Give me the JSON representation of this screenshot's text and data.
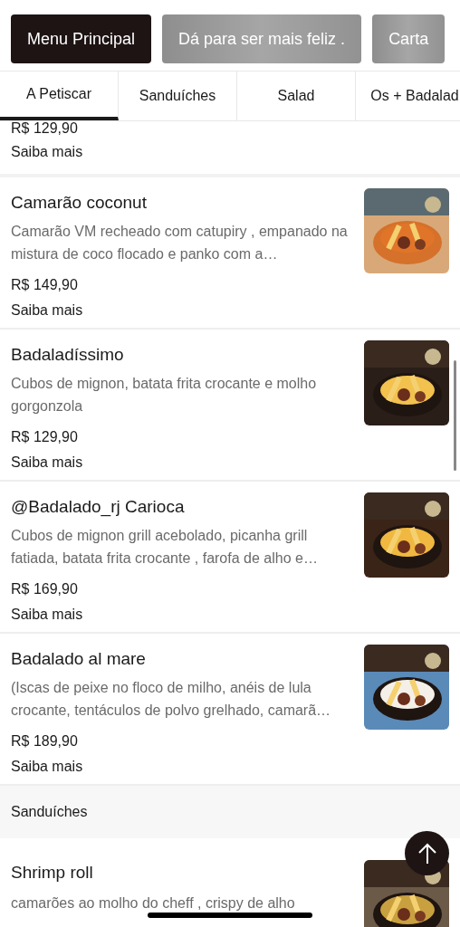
{
  "menus": [
    {
      "label": "Menu Principal",
      "selected": true
    },
    {
      "label": "Dá para ser mais feliz .",
      "selected": false
    },
    {
      "label": "Carta",
      "selected": false
    }
  ],
  "tabs": [
    {
      "label": "A Petiscar",
      "selected": true
    },
    {
      "label": "Sanduíches",
      "selected": false
    },
    {
      "label": "Salad",
      "selected": false
    },
    {
      "label": "Os + Badalad",
      "selected": false
    }
  ],
  "partial_item": {
    "price": "R$ 129,90",
    "link": "Saiba mais"
  },
  "items": [
    {
      "name": "Camarão coconut",
      "description": "Camarão VM recheado com catupiry , empanado na mistura de coco flocado e panko com a…",
      "price": "R$ 149,90",
      "link": "Saiba mais"
    },
    {
      "name": "Badaladíssimo",
      "description": "Cubos de mignon, batata frita crocante e molho gorgonzola",
      "price": "R$ 129,90",
      "link": "Saiba mais"
    },
    {
      "name": "@Badalado_rj Carioca",
      "description": "Cubos de mignon grill acebolado, picanha grill fatiada, batata frita crocante , farofa de alho e…",
      "price": "R$ 169,90",
      "link": "Saiba mais"
    },
    {
      "name": "Badalado al mare",
      "description": "(Iscas de peixe no floco de milho, anéis de lula crocante, tentáculos de polvo grelhado, camarã…",
      "price": "R$ 189,90",
      "link": "Saiba mais"
    }
  ],
  "section": {
    "title": "Sanduíches"
  },
  "last_item": {
    "name": "Shrimp roll",
    "description": "camarões ao molho do cheff , crispy de alho"
  }
}
